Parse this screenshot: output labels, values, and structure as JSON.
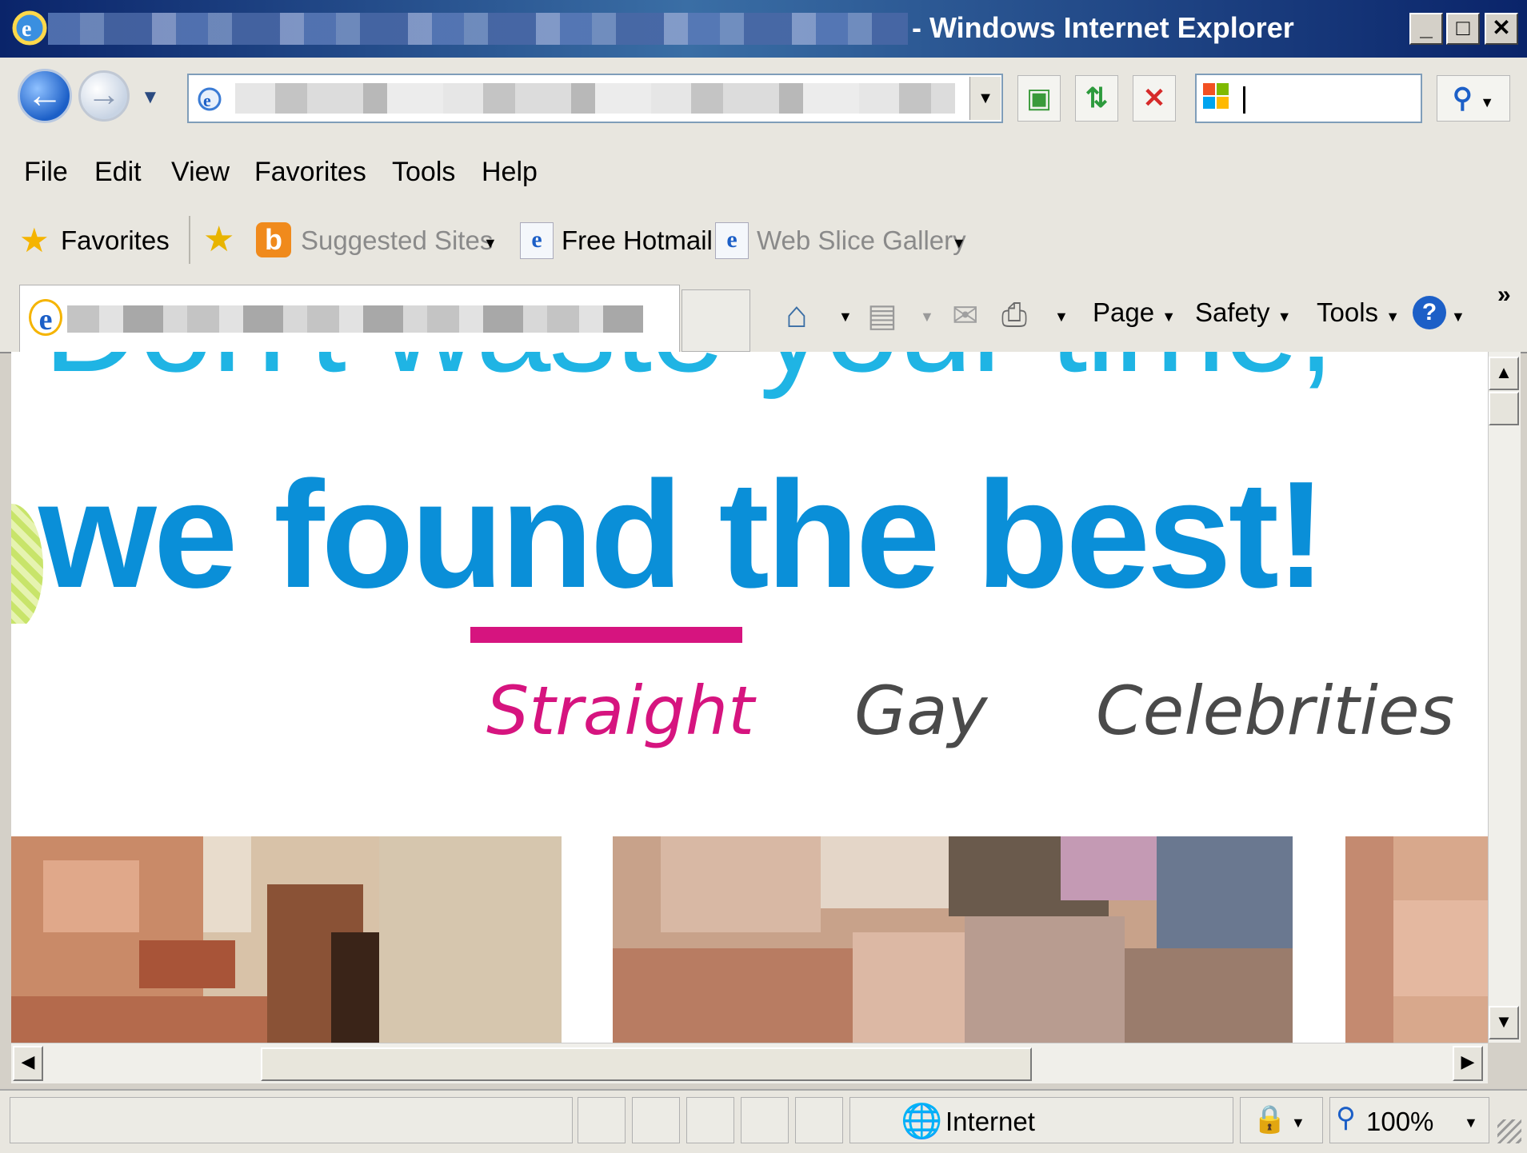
{
  "window": {
    "title": "- Windows Internet Explorer",
    "min_label": "_",
    "max_label": "□",
    "close_label": "✕"
  },
  "menu": [
    "File",
    "Edit",
    "View",
    "Favorites",
    "Tools",
    "Help"
  ],
  "favbar": {
    "favorites_label": "Favorites",
    "suggested_sites": "Suggested Sites",
    "free_hotmail": "Free Hotmail",
    "web_slice_gallery": "Web Slice Gallery"
  },
  "commandbar": {
    "page": "Page",
    "safety": "Safety",
    "tools": "Tools",
    "more": "»"
  },
  "content": {
    "headline_top": "Don't waste your time,",
    "headline_main": "we found the best!",
    "categories": {
      "straight": "Straight",
      "gay": "Gay",
      "celebrities": "Celebrities"
    }
  },
  "status": {
    "zone": "Internet",
    "zoom": "100%"
  },
  "colors": {
    "accent_pink": "#d6147f",
    "headline_blue": "#0a8fd8",
    "headline_light_blue": "#1fb4e4",
    "title_bar": "#0a246a"
  }
}
